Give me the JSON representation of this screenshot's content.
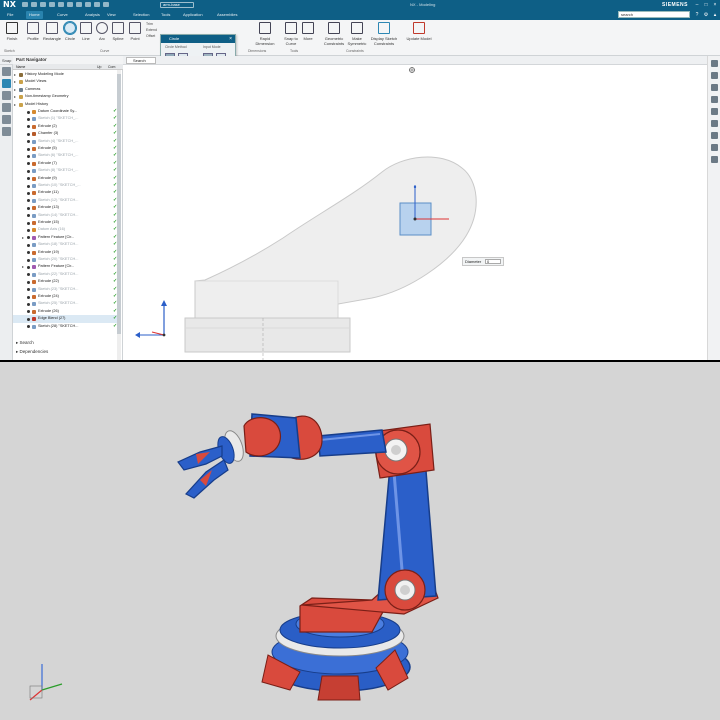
{
  "app": {
    "logo": "NX",
    "document_tab": "arm-base",
    "window_title": "NX - Modeling",
    "brand": "SIEMENS"
  },
  "menu": {
    "tabs": [
      "File",
      "Home",
      "Curve",
      "Analysis",
      "View",
      "Selection",
      "Tools",
      "Application",
      "Assemblies"
    ],
    "active_index": 1,
    "search_text": "search"
  },
  "ribbon": {
    "buttons": [
      {
        "label": "Finish",
        "icon": "finish-flag-icon"
      },
      {
        "label": "Profile",
        "icon": "profile-icon"
      },
      {
        "label": "Rectangle",
        "icon": "rectangle-icon"
      },
      {
        "label": "Circle",
        "icon": "circle-icon"
      },
      {
        "label": "Line",
        "icon": "line-icon"
      },
      {
        "label": "Arc",
        "icon": "arc-icon"
      },
      {
        "label": "Spline",
        "icon": "spline-icon"
      },
      {
        "label": "Point",
        "icon": "point-icon"
      },
      {
        "label": "Rapid Dimension",
        "icon": "rapid-dimension-icon"
      },
      {
        "label": "Snap to Curve",
        "icon": "snap-icon"
      },
      {
        "label": "More",
        "icon": "more-icon"
      },
      {
        "label": "Geometric Constraints",
        "icon": "geometric-constraints-icon"
      },
      {
        "label": "Make Symmetric",
        "icon": "make-symmetric-icon"
      },
      {
        "label": "Display Sketch Constraints",
        "icon": "display-constraints-icon"
      },
      {
        "label": "Update Model",
        "icon": "update-model-icon"
      }
    ],
    "active_index": 3,
    "small_items": [
      "Trim",
      "Extend",
      "Offset"
    ],
    "groups": [
      "Sketch",
      "Curve",
      "Dimensions",
      "Tools",
      "Constraints"
    ]
  },
  "selection_dialog": {
    "title": "Circle",
    "label_left": "Circle Method",
    "label_right": "Input Mode"
  },
  "subbar": {
    "label": "Snap",
    "search": "Search"
  },
  "part_navigator": {
    "title": "Part Navigator",
    "columns": [
      "Name",
      "Up",
      "Com"
    ],
    "rows": [
      {
        "name": "History Modeling Mode",
        "indent": 1,
        "type": "mode",
        "dim": false,
        "check": false
      },
      {
        "name": "Model Views",
        "indent": 1,
        "type": "folder",
        "dim": false,
        "check": false
      },
      {
        "name": "Cameras",
        "indent": 1,
        "type": "camera",
        "dim": false,
        "check": false
      },
      {
        "name": "Non-timestamp Geometry",
        "indent": 1,
        "type": "folder",
        "dim": false,
        "check": false
      },
      {
        "name": "Model History",
        "indent": 1,
        "type": "folder",
        "dim": false,
        "check": false
      },
      {
        "name": "Datum Coordinate Sy...",
        "indent": 2,
        "type": "datum",
        "dim": false,
        "check": true
      },
      {
        "name": "Sketch (1) \"SKETCH_...",
        "indent": 2,
        "type": "sketch",
        "dim": true,
        "check": true
      },
      {
        "name": "Extrude (2)",
        "indent": 2,
        "type": "extrude",
        "dim": false,
        "check": true
      },
      {
        "name": "Chamfer (3)",
        "indent": 2,
        "type": "chamfer",
        "dim": false,
        "check": true
      },
      {
        "name": "Sketch (4) \"SKETCH_...",
        "indent": 2,
        "type": "sketch",
        "dim": true,
        "check": true
      },
      {
        "name": "Extrude (5)",
        "indent": 2,
        "type": "extrude",
        "dim": false,
        "check": true
      },
      {
        "name": "Sketch (6) \"SKETCH_...",
        "indent": 2,
        "type": "sketch",
        "dim": true,
        "check": true
      },
      {
        "name": "Extrude (7)",
        "indent": 2,
        "type": "extrude",
        "dim": false,
        "check": true
      },
      {
        "name": "Sketch (8) \"SKETCH_...",
        "indent": 2,
        "type": "sketch",
        "dim": true,
        "check": true
      },
      {
        "name": "Extrude (9)",
        "indent": 2,
        "type": "extrude",
        "dim": false,
        "check": true
      },
      {
        "name": "Sketch (10) \"SKETCH_...",
        "indent": 2,
        "type": "sketch",
        "dim": true,
        "check": true
      },
      {
        "name": "Extrude (11)",
        "indent": 2,
        "type": "extrude",
        "dim": false,
        "check": true
      },
      {
        "name": "Sketch (12) \"SKETCH...",
        "indent": 2,
        "type": "sketch",
        "dim": true,
        "check": true
      },
      {
        "name": "Extrude (13)",
        "indent": 2,
        "type": "extrude",
        "dim": false,
        "check": true
      },
      {
        "name": "Sketch (14) \"SKETCH...",
        "indent": 2,
        "type": "sketch",
        "dim": true,
        "check": true
      },
      {
        "name": "Extrude (15)",
        "indent": 2,
        "type": "extrude",
        "dim": false,
        "check": true
      },
      {
        "name": "Datum Axis (16)",
        "indent": 2,
        "type": "datum",
        "dim": true,
        "check": true
      },
      {
        "name": "Pattern Feature [Cir...",
        "indent": 2,
        "type": "pattern",
        "dim": false,
        "check": true
      },
      {
        "name": "Sketch (18) \"SKETCH...",
        "indent": 2,
        "type": "sketch",
        "dim": true,
        "check": true
      },
      {
        "name": "Extrude (19)",
        "indent": 2,
        "type": "extrude",
        "dim": false,
        "check": true
      },
      {
        "name": "Sketch (20) \"SKETCH...",
        "indent": 2,
        "type": "sketch",
        "dim": true,
        "check": true
      },
      {
        "name": "Pattern Feature [Cir...",
        "indent": 2,
        "type": "pattern",
        "dim": false,
        "check": true
      },
      {
        "name": "Sketch (22) \"SKETCH...",
        "indent": 2,
        "type": "sketch",
        "dim": true,
        "check": true
      },
      {
        "name": "Extrude (22)",
        "indent": 2,
        "type": "extrude",
        "dim": false,
        "check": true
      },
      {
        "name": "Sketch (23) \"SKETCH...",
        "indent": 2,
        "type": "sketch",
        "dim": true,
        "check": true
      },
      {
        "name": "Extrude (24)",
        "indent": 2,
        "type": "extrude",
        "dim": false,
        "check": true
      },
      {
        "name": "Sketch (25) \"SKETCH...",
        "indent": 2,
        "type": "sketch",
        "dim": true,
        "check": true
      },
      {
        "name": "Extrude (26)",
        "indent": 2,
        "type": "extrude",
        "dim": false,
        "check": true
      },
      {
        "name": "Edge Blend (27)",
        "indent": 2,
        "type": "blend",
        "dim": false,
        "check": true
      },
      {
        "name": "Sketch (28) \"SKETCH...",
        "indent": 2,
        "type": "sketch",
        "dim": false,
        "check": true
      }
    ],
    "selected_index": 33,
    "footer": [
      "Search",
      "Dependencies"
    ]
  },
  "graphics": {
    "dimension_label": "Diameter",
    "dimension_value": "0"
  },
  "colors": {
    "titlebar": "#0e5f86",
    "accent": "#2d87b3",
    "check": "#2a9d2a",
    "robot_red": "#d94a3d",
    "robot_blue": "#2b5fc9",
    "render_bg": "#d5d5d5"
  }
}
